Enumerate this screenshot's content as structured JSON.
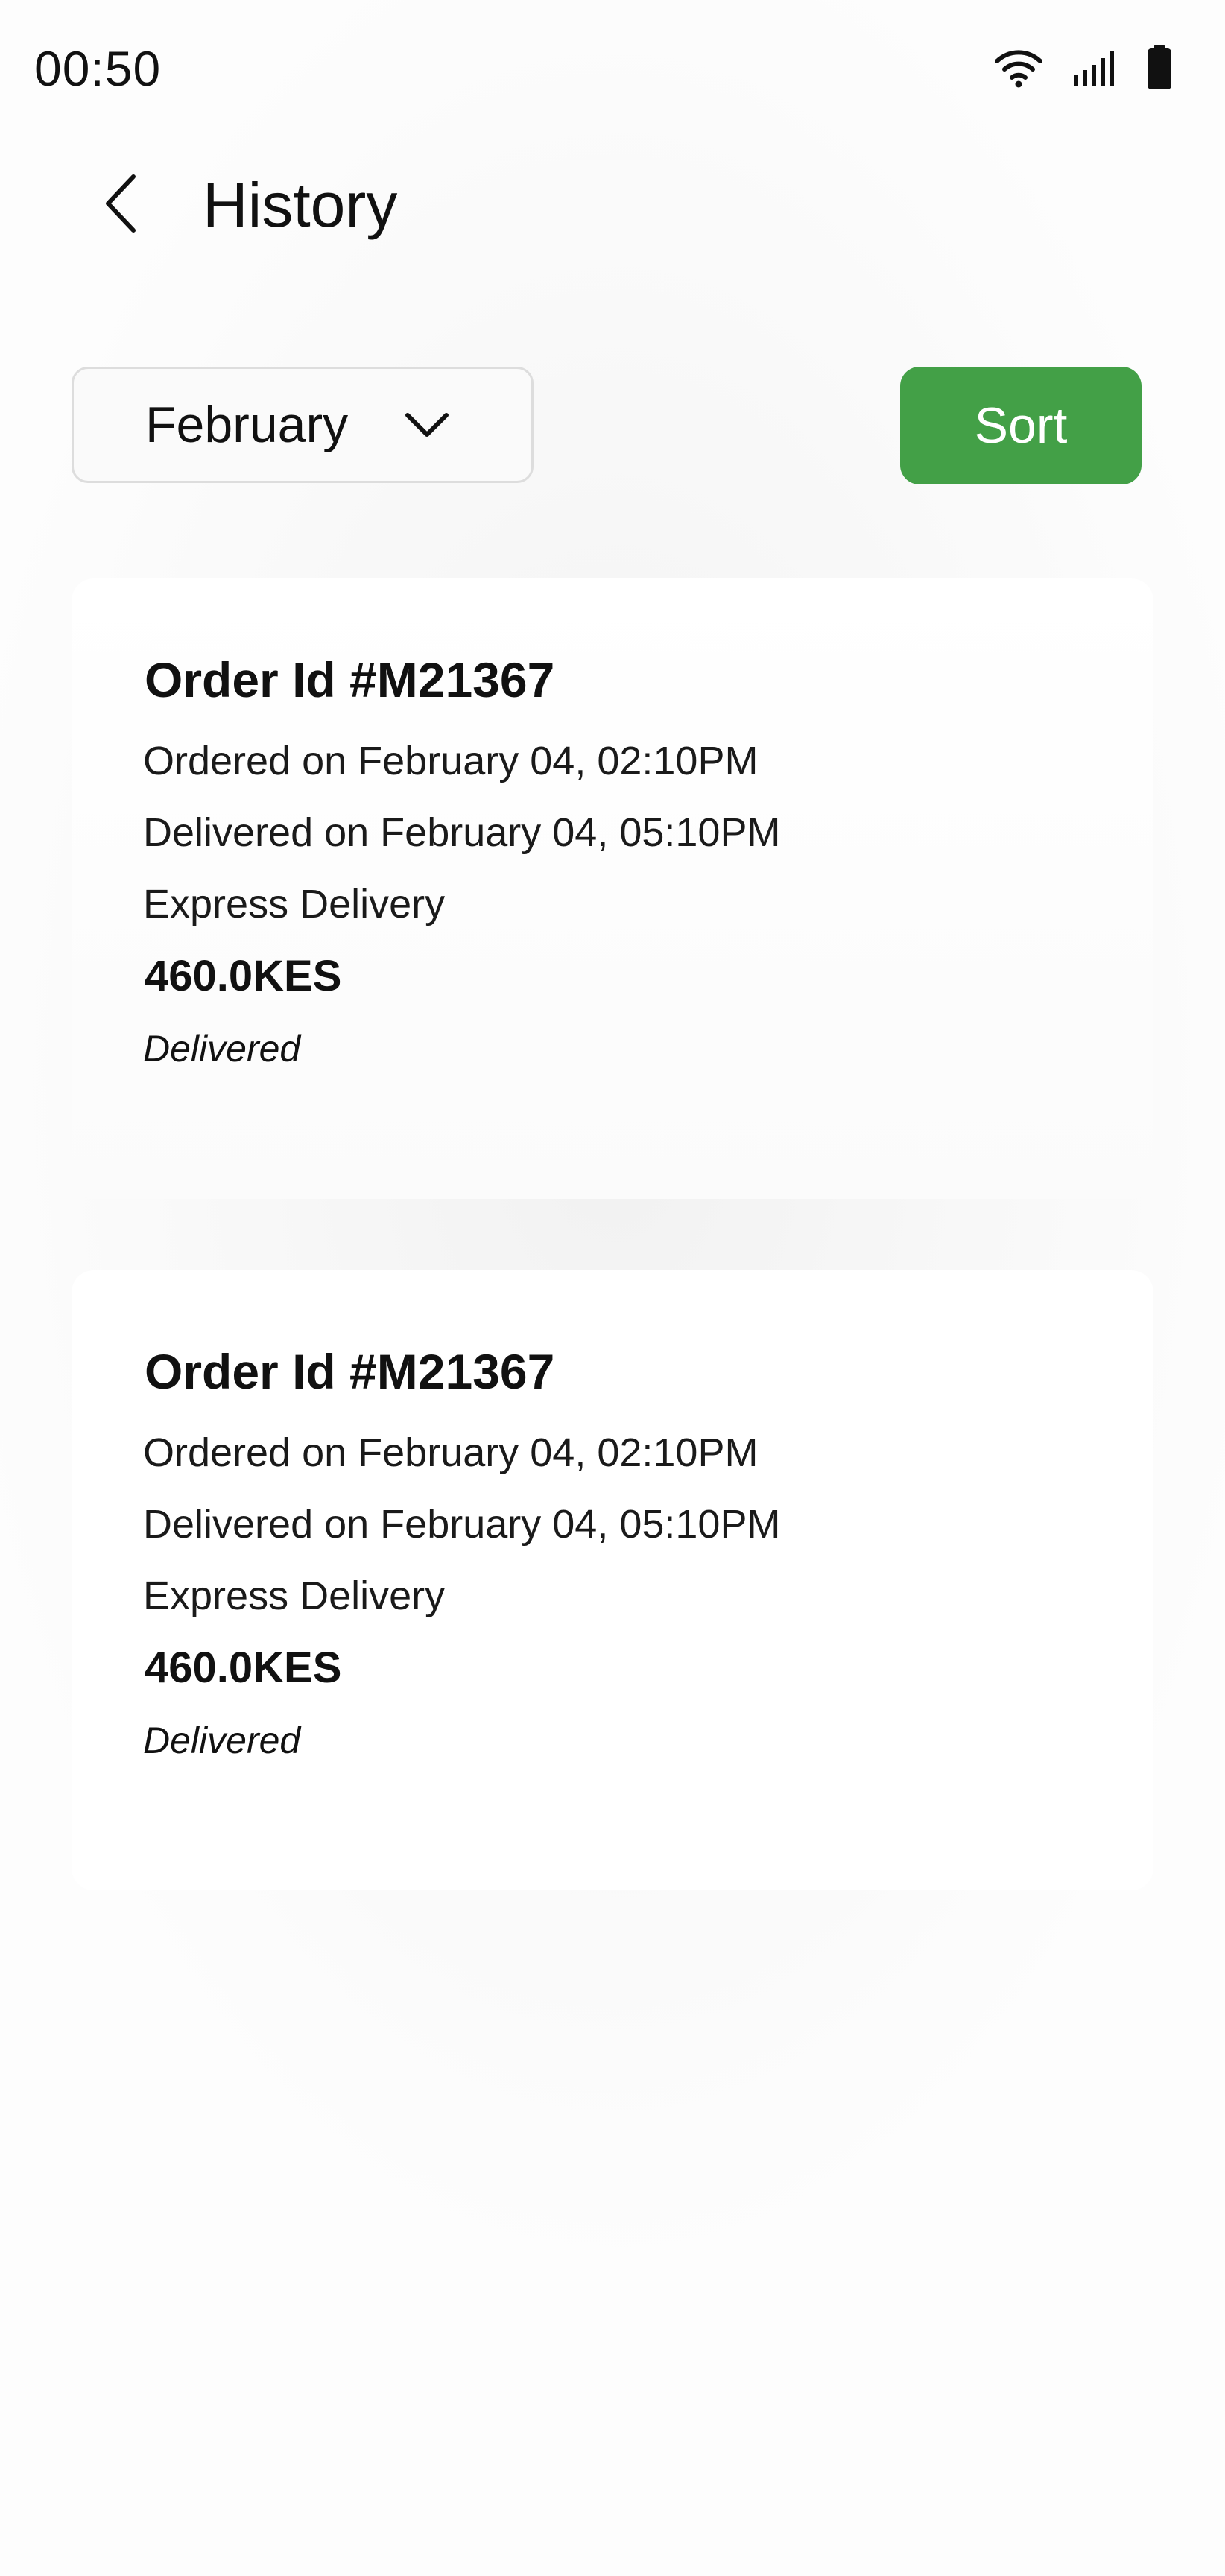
{
  "status_bar": {
    "time": "00:50",
    "icons": [
      "wifi-icon",
      "cellular-signal-icon",
      "battery-icon"
    ]
  },
  "header": {
    "back_icon": "chevron-left-icon",
    "title": "History"
  },
  "filters": {
    "month": {
      "selected": "February",
      "icon": "chevron-down-icon"
    },
    "sort_label": "Sort"
  },
  "orders": [
    {
      "order_id": "Order Id #M21367",
      "ordered_on": "Ordered on February 04, 02:10PM",
      "delivered_on": "Delivered on February 04, 05:10PM",
      "delivery_type": "Express Delivery",
      "amount": "460.0KES",
      "status": "Delivered"
    },
    {
      "order_id": "Order Id #M21367",
      "ordered_on": "Ordered on February 04, 02:10PM",
      "delivered_on": "Delivered on February 04, 05:10PM",
      "delivery_type": "Express Delivery",
      "amount": "460.0KES",
      "status": "Delivered"
    }
  ],
  "colors": {
    "accent": "#43a047",
    "card_background": "#ffffff",
    "page_background": "#f7f7f7",
    "text_primary": "#111111",
    "border": "#dddddd"
  }
}
